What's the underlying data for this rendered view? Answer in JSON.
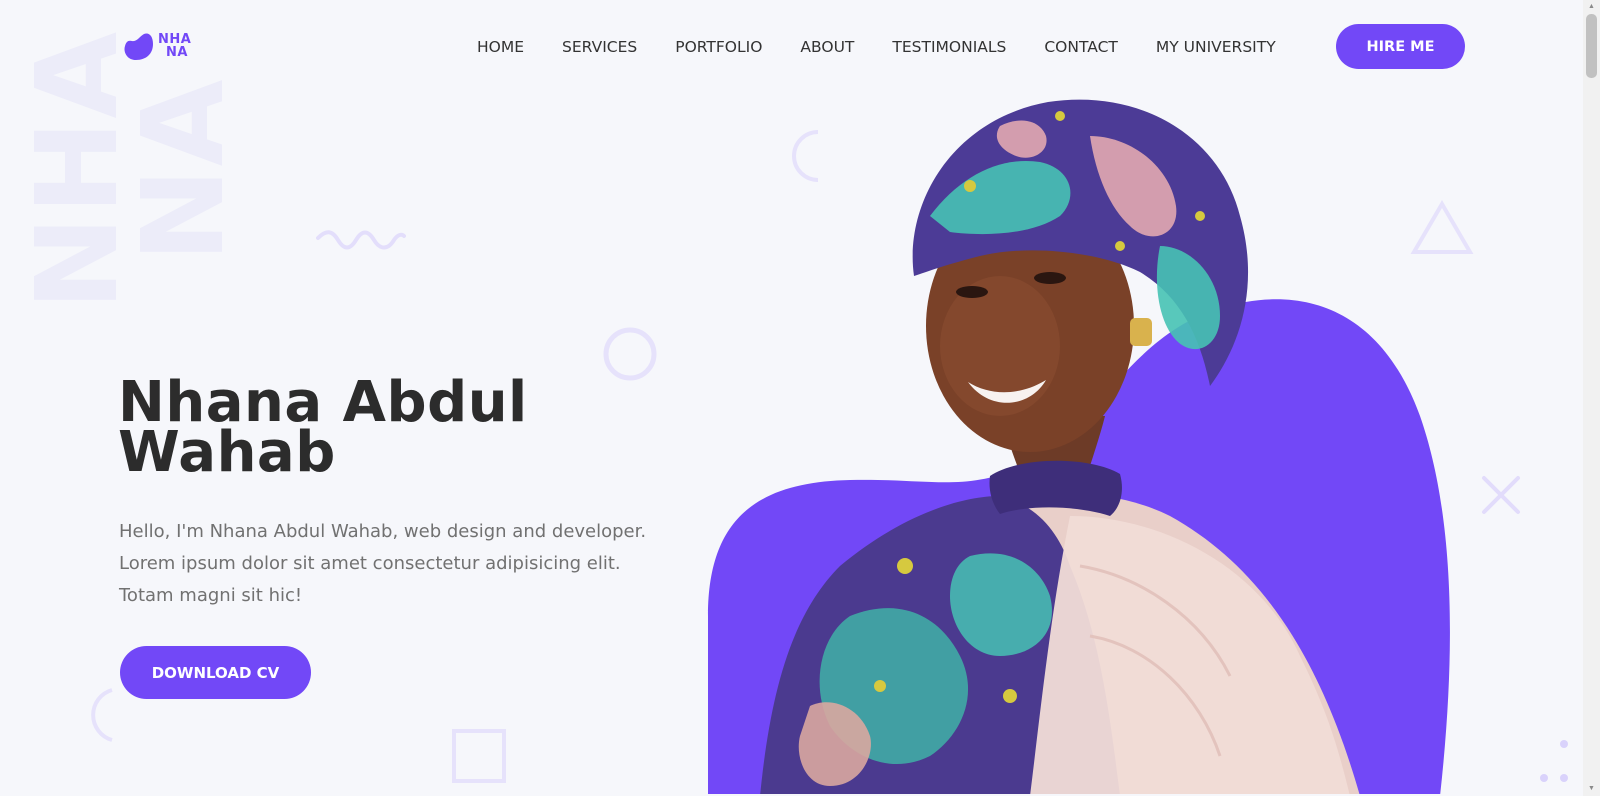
{
  "brand": {
    "logo_line1": "NHA",
    "logo_line2": "NA",
    "watermark_line1": "NHA",
    "watermark_line2": "NA",
    "accent_color": "#7248F7"
  },
  "nav": {
    "items": [
      {
        "label": "HOME"
      },
      {
        "label": "SERVICES"
      },
      {
        "label": "PORTFOLIO"
      },
      {
        "label": "ABOUT"
      },
      {
        "label": "TESTIMONIALS"
      },
      {
        "label": "CONTACT"
      },
      {
        "label": "MY UNIVERSITY"
      }
    ],
    "cta_label": "HIRE ME"
  },
  "hero": {
    "name_line1": "Nhana Abdul",
    "name_line2": "Wahab",
    "description": "Hello, I'm Nhana Abdul Wahab, web design and developer. Lorem ipsum dolor sit amet consectetur adipisicing elit. Totam magni sit hic!",
    "cta_label": "DOWNLOAD CV"
  },
  "icons": {
    "logo": "logo-blob-icon",
    "decor_shapes": [
      "arc-icon",
      "wave-icon",
      "ring-icon",
      "triangle-icon",
      "cross-icon",
      "square-icon",
      "dots-icon"
    ]
  }
}
